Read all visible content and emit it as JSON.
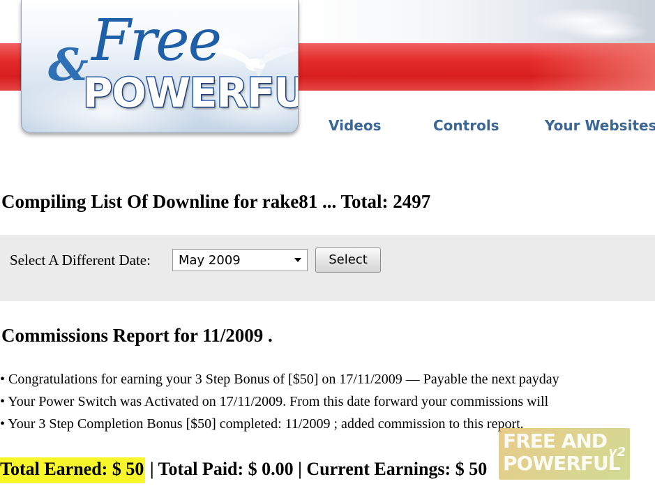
{
  "logo": {
    "word_free": "Free",
    "ampersand": "&",
    "word_powerful": "POWERFUL"
  },
  "nav": {
    "items": [
      {
        "label": "Videos"
      },
      {
        "label": "Controls"
      },
      {
        "label": "Your Websites"
      }
    ]
  },
  "downline": {
    "heading": "Compiling List Of Downline for rake81 ... Total: 2497"
  },
  "date_picker": {
    "label": "Select A Different Date:",
    "selected": "May 2009",
    "button_label": "Select"
  },
  "report": {
    "heading": "Commissions Report for 11/2009 .",
    "items": [
      "• Congratulations for earning your 3 Step Bonus of [$50] on 17/11/2009 — Payable the next payday",
      "• Your Power Switch was Activated on 17/11/2009. From this date forward your commissions will",
      "• Your 3 Step Completion Bonus [$50] completed: 11/2009 ; added commission to this report."
    ]
  },
  "totals": {
    "earned": "Total Earned: $ 50",
    "rest": " | Total Paid: $ 0.00 | Current Earnings: $ 50"
  },
  "watermark": {
    "line1": "FREE AND",
    "line2": "POWERFUL",
    "version": "v2"
  },
  "colors": {
    "red_band": "#e52d2d",
    "nav_text": "#3b6796",
    "highlight": "#f6f62a",
    "logo_blue": "#1f5fa8"
  }
}
